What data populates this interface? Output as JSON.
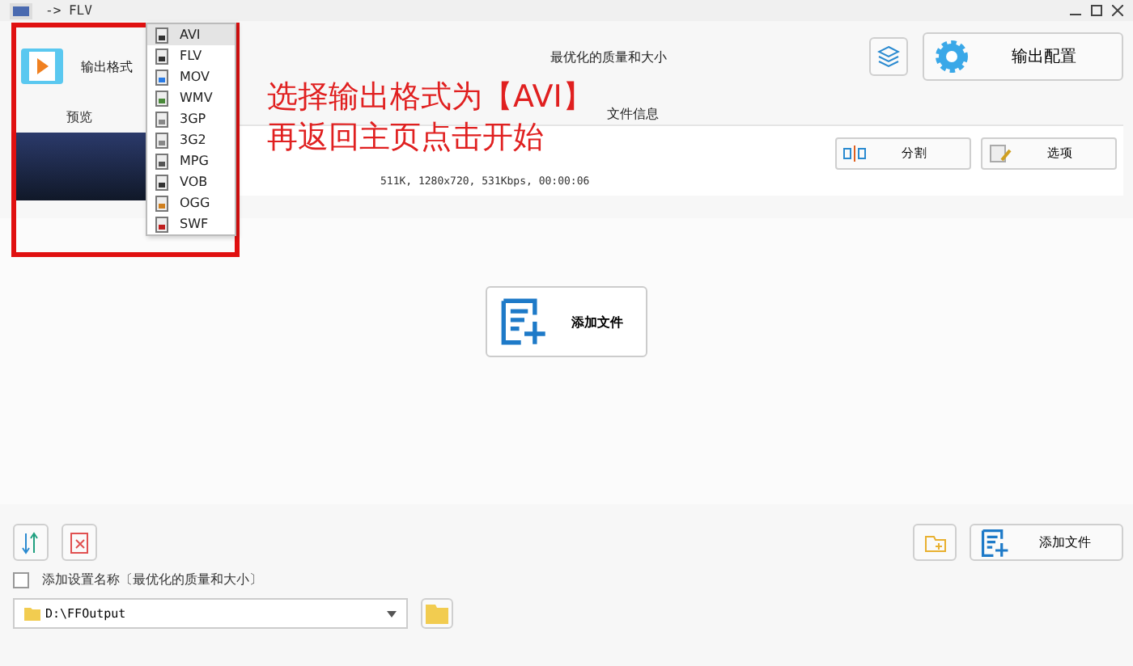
{
  "window": {
    "title": "-> FLV"
  },
  "output_format": {
    "label": "输出格式"
  },
  "preview": {
    "label": "预览"
  },
  "format_menu": [
    {
      "label": "AVI",
      "selected": true
    },
    {
      "label": "FLV",
      "selected": false
    },
    {
      "label": "MOV",
      "selected": false
    },
    {
      "label": "WMV",
      "selected": false
    },
    {
      "label": "3GP",
      "selected": false
    },
    {
      "label": "3G2",
      "selected": false
    },
    {
      "label": "MPG",
      "selected": false
    },
    {
      "label": "VOB",
      "selected": false
    },
    {
      "label": "OGG",
      "selected": false
    },
    {
      "label": "SWF",
      "selected": false
    }
  ],
  "preset": {
    "label": "最优化的质量和大小"
  },
  "output_config_button": "输出配置",
  "file_info": {
    "label": "文件信息",
    "details": "511K, 1280x720, 531Kbps, 00:00:06",
    "split_button": "分割",
    "options_button": "选项"
  },
  "annotation": {
    "lines": [
      "选择输出格式为【AVI】",
      "再返回主页点击开始"
    ]
  },
  "add_file_center": "添加文件",
  "add_name": {
    "label": "添加设置名称〔最优化的质量和大小〕",
    "checked": false
  },
  "output_path": {
    "value": "D:\\FFOutput"
  },
  "add_file_button": "添加文件"
}
